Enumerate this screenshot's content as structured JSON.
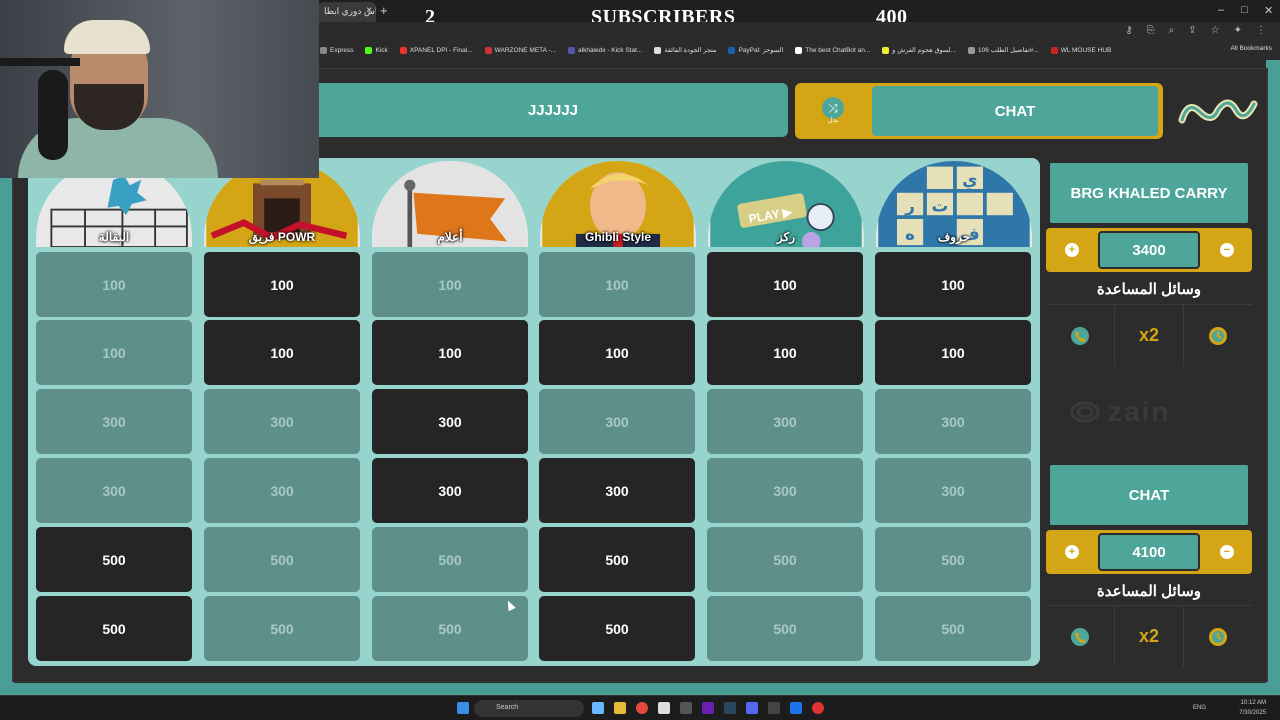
{
  "browser": {
    "tab_title": "كاس دوري ابطا",
    "tab_close": "×",
    "new_tab": "+",
    "overlay": {
      "left_count": "2",
      "label": "SUBSCRIBERS",
      "right_count": "400"
    },
    "window_controls": [
      "–",
      "□",
      "✕"
    ],
    "bookmarks": [
      "Express",
      "Kick",
      "XPANEL DPI - Final...",
      "WARZONE META -...",
      "alkhaledx - Kick Stat...",
      "متجر الجودة الفائقة",
      "PayPal: السوجز",
      "The best ChatBot an...",
      "لسوق هجوم الفرش و...",
      "تفاصيل الطلب 106#...",
      "WL MOUSE HUB"
    ],
    "all_bookmarks": "All Bookmarks"
  },
  "game": {
    "team_left": "JJJJJJ",
    "team_right": "CHAT",
    "swap_label": "بدل",
    "swap_icon": "shuffle-icon",
    "colors": {
      "teal": "#4ea59a",
      "gold": "#d4a514",
      "used": "#5f8f8a",
      "open": "#252525"
    },
    "categories": [
      {
        "label": "البقالة",
        "art": "grocery"
      },
      {
        "label": "فريق POWR",
        "art": "room"
      },
      {
        "label": "أعلام",
        "art": "flag"
      },
      {
        "label": "Ghibli Style",
        "art": "portrait"
      },
      {
        "label": "ركز",
        "art": "play"
      },
      {
        "label": "حروف",
        "art": "letters"
      }
    ],
    "grid": [
      [
        {
          "v": "100",
          "s": "used"
        },
        {
          "v": "100",
          "s": "open"
        },
        {
          "v": "100",
          "s": "used"
        },
        {
          "v": "100",
          "s": "used"
        },
        {
          "v": "100",
          "s": "open"
        },
        {
          "v": "100",
          "s": "open"
        }
      ],
      [
        {
          "v": "100",
          "s": "used"
        },
        {
          "v": "100",
          "s": "open"
        },
        {
          "v": "100",
          "s": "open"
        },
        {
          "v": "100",
          "s": "open"
        },
        {
          "v": "100",
          "s": "open"
        },
        {
          "v": "100",
          "s": "open"
        }
      ],
      [
        {
          "v": "300",
          "s": "used"
        },
        {
          "v": "300",
          "s": "used"
        },
        {
          "v": "300",
          "s": "open"
        },
        {
          "v": "300",
          "s": "used"
        },
        {
          "v": "300",
          "s": "used"
        },
        {
          "v": "300",
          "s": "used"
        }
      ],
      [
        {
          "v": "300",
          "s": "used"
        },
        {
          "v": "300",
          "s": "used"
        },
        {
          "v": "300",
          "s": "open"
        },
        {
          "v": "300",
          "s": "open"
        },
        {
          "v": "300",
          "s": "used"
        },
        {
          "v": "300",
          "s": "used"
        }
      ],
      [
        {
          "v": "500",
          "s": "open"
        },
        {
          "v": "500",
          "s": "used"
        },
        {
          "v": "500",
          "s": "used"
        },
        {
          "v": "500",
          "s": "open"
        },
        {
          "v": "500",
          "s": "used"
        },
        {
          "v": "500",
          "s": "used"
        }
      ],
      [
        {
          "v": "500",
          "s": "open"
        },
        {
          "v": "500",
          "s": "used"
        },
        {
          "v": "500",
          "s": "used"
        },
        {
          "v": "500",
          "s": "open"
        },
        {
          "v": "500",
          "s": "used"
        },
        {
          "v": "500",
          "s": "used"
        }
      ]
    ],
    "teams": [
      {
        "name": "BRG KHALED CARRY",
        "score": "3400",
        "plus": "+",
        "minus": "−",
        "help_title": "وسائل المساعدة",
        "help": [
          "phone-call-icon",
          "x2",
          "clock-icon"
        ]
      },
      {
        "name": "CHAT",
        "score": "4100",
        "plus": "+",
        "minus": "−",
        "help_title": "وسائل المساعدة",
        "help": [
          "phone-call-icon",
          "x2",
          "clock-icon"
        ]
      }
    ],
    "sponsor": "zain",
    "play_badge": "PLAY ▶",
    "letter_tiles": [
      "ي",
      "ت",
      "ر",
      "ف",
      "ه"
    ]
  },
  "taskbar": {
    "search_placeholder": "Search",
    "lang": "ENG",
    "time": "10:12 AM",
    "date": "7/30/2025"
  }
}
